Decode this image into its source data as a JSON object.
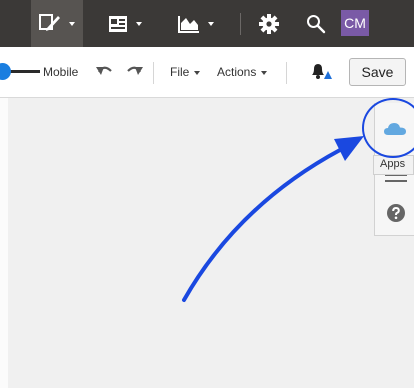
{
  "topbar": {
    "background": "#3b3937",
    "edit_icon": "pencil-edit-icon",
    "media_icon": "image-media-icon",
    "chart_icon": "chart-icon",
    "settings_icon": "gear-icon",
    "search_icon": "search-icon",
    "avatar_initials": "CM",
    "avatar_color": "#7a5aa6"
  },
  "toolbar": {
    "mobile_label": "Mobile",
    "undo_icon": "undo-icon",
    "redo_icon": "redo-icon",
    "file_label": "File",
    "actions_label": "Actions",
    "notifications_icon": "bell-icon",
    "save_label": "Save"
  },
  "side_panel": {
    "apps_icon": "cloud-icon",
    "apps_tooltip": "Apps",
    "list_icon": "list-icon",
    "help_icon": "help-icon"
  },
  "annotation": {
    "highlight_color": "#1a48e0"
  }
}
